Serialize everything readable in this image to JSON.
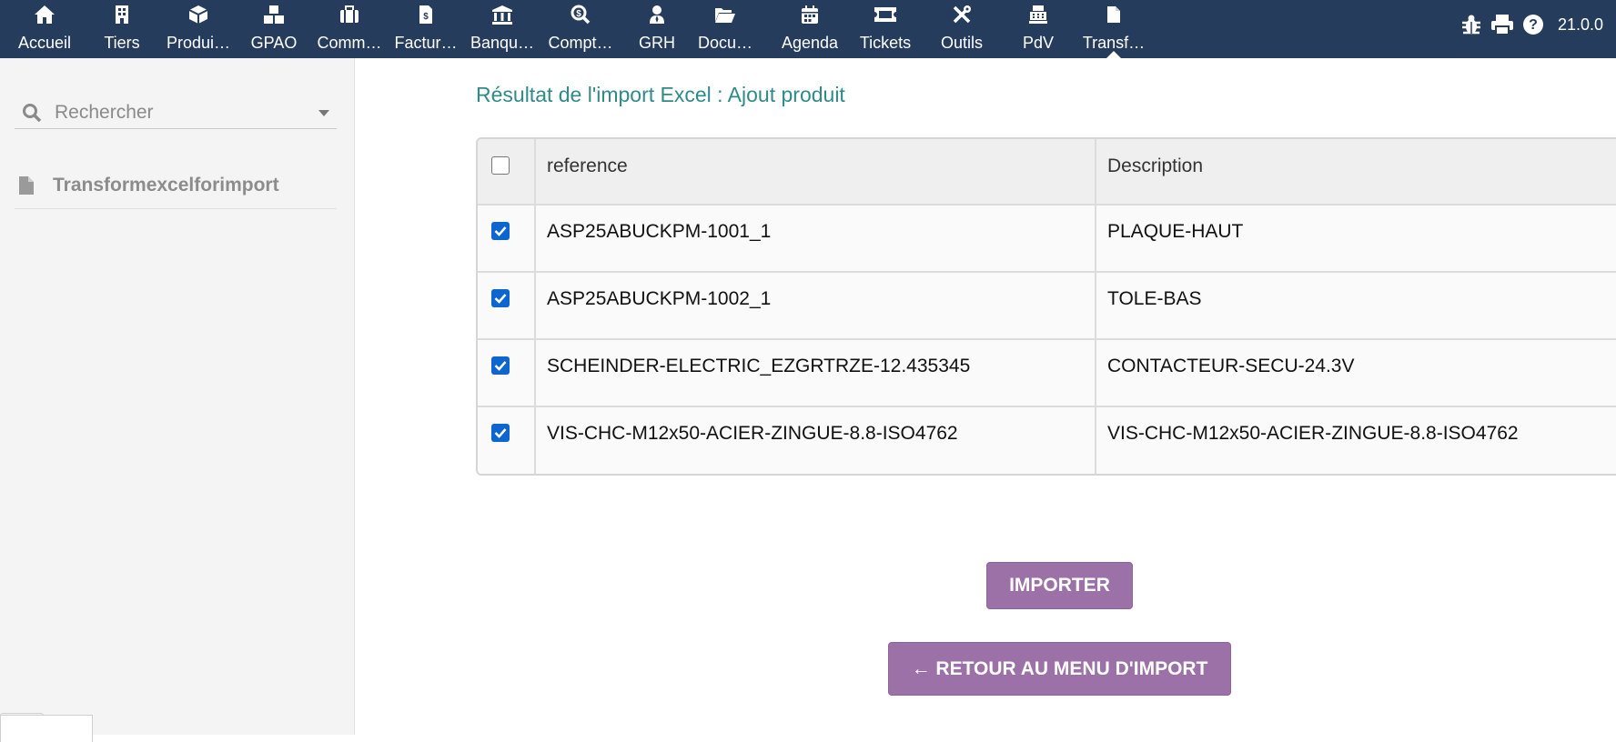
{
  "topbar": {
    "items": [
      {
        "label": "Accueil",
        "icon": "home-icon"
      },
      {
        "label": "Tiers",
        "icon": "building-icon"
      },
      {
        "label": "Produi…",
        "icon": "cube-icon"
      },
      {
        "label": "GPAO",
        "icon": "cubes-icon"
      },
      {
        "label": "Comm…",
        "icon": "suitcase-icon"
      },
      {
        "label": "Factur…",
        "icon": "invoice-icon"
      },
      {
        "label": "Banqu…",
        "icon": "bank-icon"
      },
      {
        "label": "Compt…",
        "icon": "search-dollar-icon"
      },
      {
        "label": "GRH",
        "icon": "user-tie-icon"
      },
      {
        "label": "Docu…",
        "icon": "folder-open-icon"
      },
      {
        "label": "Agenda",
        "icon": "calendar-icon"
      },
      {
        "label": "Tickets",
        "icon": "ticket-icon"
      },
      {
        "label": "Outils",
        "icon": "tools-icon"
      },
      {
        "label": "PdV",
        "icon": "cash-register-icon"
      },
      {
        "label": "Transf…",
        "icon": "file-icon"
      }
    ],
    "version": "21.0.0",
    "right_icons": [
      "bug-icon",
      "print-icon",
      "help-icon"
    ]
  },
  "sidebar": {
    "search_placeholder": "Rechercher",
    "menu_item": "Transformexcelforimport"
  },
  "main": {
    "title": "Résultat de l'import Excel : Ajout produit",
    "table": {
      "headers": [
        "reference",
        "Description"
      ],
      "select_all_checked": false,
      "rows": [
        {
          "checked": true,
          "reference": "ASP25ABUCKPM-1001_1",
          "description": "PLAQUE-HAUT"
        },
        {
          "checked": true,
          "reference": "ASP25ABUCKPM-1002_1",
          "description": "TOLE-BAS"
        },
        {
          "checked": true,
          "reference": "SCHEINDER-ELECTRIC_EZGRTRZE-12.435345",
          "description": "CONTACTEUR-SECU-24.3V"
        },
        {
          "checked": true,
          "reference": "VIS-CHC-M12x50-ACIER-ZINGUE-8.8-ISO4762",
          "description": "VIS-CHC-M12x50-ACIER-ZINGUE-8.8-ISO4762"
        }
      ]
    },
    "import_button": "IMPORTER",
    "back_button": "← RETOUR AU MENU D'IMPORT"
  },
  "colors": {
    "topbar": "#263c5c",
    "title": "#2e8b88",
    "button": "#9b71a7",
    "checkbox": "#0d66d0"
  }
}
